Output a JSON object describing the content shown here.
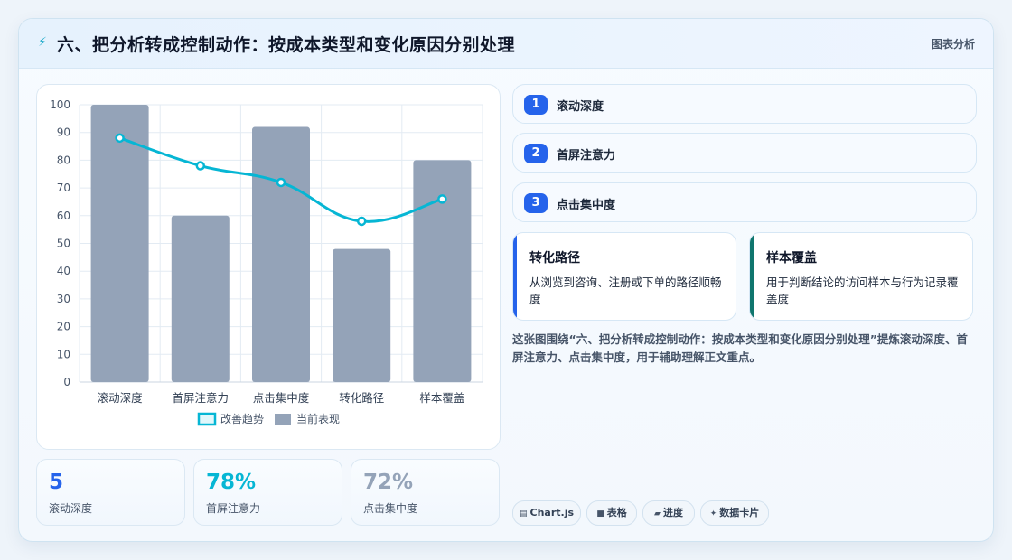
{
  "header": {
    "icon": "bolt-icon",
    "title": "六、把分析转成控制动作：按成本类型和变化原因分别处理",
    "tag": "图表分析"
  },
  "chart_data": {
    "type": "bar",
    "categories": [
      "滚动深度",
      "首屏注意力",
      "点击集中度",
      "转化路径",
      "样本覆盖"
    ],
    "series": [
      {
        "name": "当前表现",
        "type": "bar",
        "values": [
          100,
          60,
          92,
          48,
          80
        ],
        "color": "#94a3b8"
      },
      {
        "name": "改善趋势",
        "type": "line",
        "values": [
          88,
          78,
          72,
          58,
          66
        ],
        "color": "#06b6d4"
      }
    ],
    "ylim": [
      0,
      100
    ],
    "yticks": [
      0,
      10,
      20,
      30,
      40,
      50,
      60,
      70,
      80,
      90,
      100
    ],
    "grid": true,
    "legend": "bottom",
    "legend_order": [
      "改善趋势",
      "当前表现"
    ]
  },
  "stats": [
    {
      "value": "5",
      "label": "滚动深度",
      "color": "#2563eb"
    },
    {
      "value": "78%",
      "label": "首屏注意力",
      "color": "#06b6d4"
    },
    {
      "value": "72%",
      "label": "点击集中度",
      "color": "#94a3b8"
    }
  ],
  "steps": [
    {
      "num": "1",
      "label": "滚动深度"
    },
    {
      "num": "2",
      "label": "首屏注意力"
    },
    {
      "num": "3",
      "label": "点击集中度"
    }
  ],
  "features": [
    {
      "title": "转化路径",
      "desc": "从浏览到咨询、注册或下单的路径顺畅度",
      "color": "#2563eb"
    },
    {
      "title": "样本覆盖",
      "desc": "用于判断结论的访问样本与行为记录覆盖度",
      "color": "#0f766e"
    }
  ],
  "summary": "这张图围绕“六、把分析转成控制动作：按成本类型和变化原因分别处理”提炼滚动深度、首屏注意力、点击集中度，用于辅助理解正文重点。",
  "chips": [
    {
      "icon": "chart-icon",
      "glyph": "▤",
      "label": "Chart.js"
    },
    {
      "icon": "table-icon",
      "glyph": "■",
      "label": "表格"
    },
    {
      "icon": "progress-icon",
      "glyph": "▰",
      "label": "进度"
    },
    {
      "icon": "sparkle-icon",
      "glyph": "✦",
      "label": "数据卡片"
    }
  ]
}
